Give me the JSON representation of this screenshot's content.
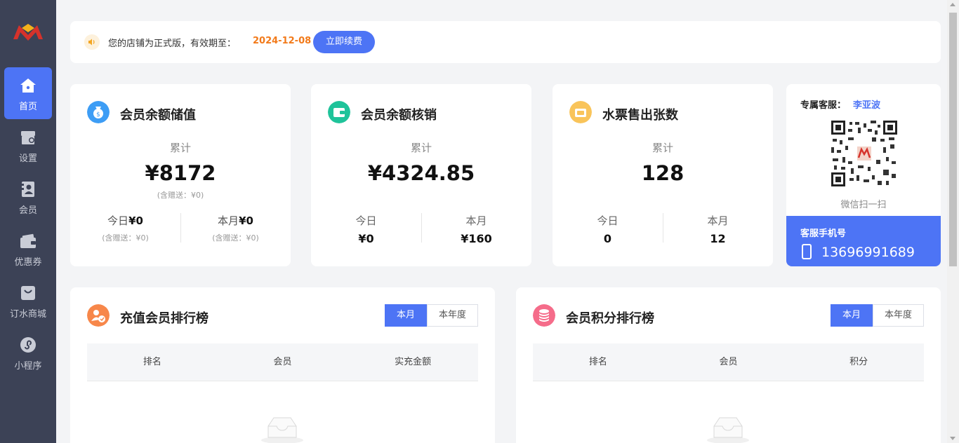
{
  "colors": {
    "accent": "#4d74f5",
    "sidebar": "#3c4256",
    "highlight_orange": "#f27a1a"
  },
  "sidebar": {
    "items": [
      {
        "label": "首页",
        "icon": "home-icon",
        "active": true
      },
      {
        "label": "设置",
        "icon": "store-settings-icon"
      },
      {
        "label": "会员",
        "icon": "member-icon"
      },
      {
        "label": "优惠券",
        "icon": "wallet-icon"
      },
      {
        "label": "订水商城",
        "icon": "shopping-bag-icon"
      },
      {
        "label": "小程序",
        "icon": "mini-program-icon"
      }
    ]
  },
  "notice": {
    "icon": "speaker-icon",
    "text": "您的店铺为正式版，有效期至：",
    "expiry": "2024-12-08",
    "renew_label": "立即续费"
  },
  "stats": [
    {
      "title": "会员余额储值",
      "icon": "money-bag-icon",
      "icon_color": "#3d9df5",
      "sub": "累计",
      "total": "¥8172",
      "total_gift": "(含赠送：¥0)",
      "today_label": "今日",
      "today_value": "¥0",
      "today_gift": "(含赠送：¥0)",
      "month_label": "本月",
      "month_value": "¥0",
      "month_gift": "(含赠送：¥0)"
    },
    {
      "title": "会员余额核销",
      "icon": "wallet-icon",
      "icon_color": "#1fc39a",
      "sub": "累计",
      "total": "¥4324.85",
      "today_label": "今日",
      "today_value": "¥0",
      "month_label": "本月",
      "month_value": "¥160"
    },
    {
      "title": "水票售出张数",
      "icon": "ticket-icon",
      "icon_color": "#f9c45a",
      "sub": "累计",
      "total": "128",
      "today_label": "今日",
      "today_value": "0",
      "month_label": "本月",
      "month_value": "12"
    }
  ],
  "service": {
    "label": "专属客服：",
    "name": "李亚波",
    "qr_caption": "微信扫一扫",
    "phone_label": "客服手机号",
    "phone": "13696991689"
  },
  "rankings": [
    {
      "title": "充值会员排行榜",
      "icon": "member-recharge-icon",
      "icon_color": "#f7874a",
      "tabs": [
        "本月",
        "本年度"
      ],
      "columns": [
        "排名",
        "会员",
        "实充金额"
      ]
    },
    {
      "title": "会员积分排行榜",
      "icon": "coin-stack-icon",
      "icon_color": "#f56c8a",
      "tabs": [
        "本月",
        "本年度"
      ],
      "columns": [
        "排名",
        "会员",
        "积分"
      ]
    }
  ]
}
